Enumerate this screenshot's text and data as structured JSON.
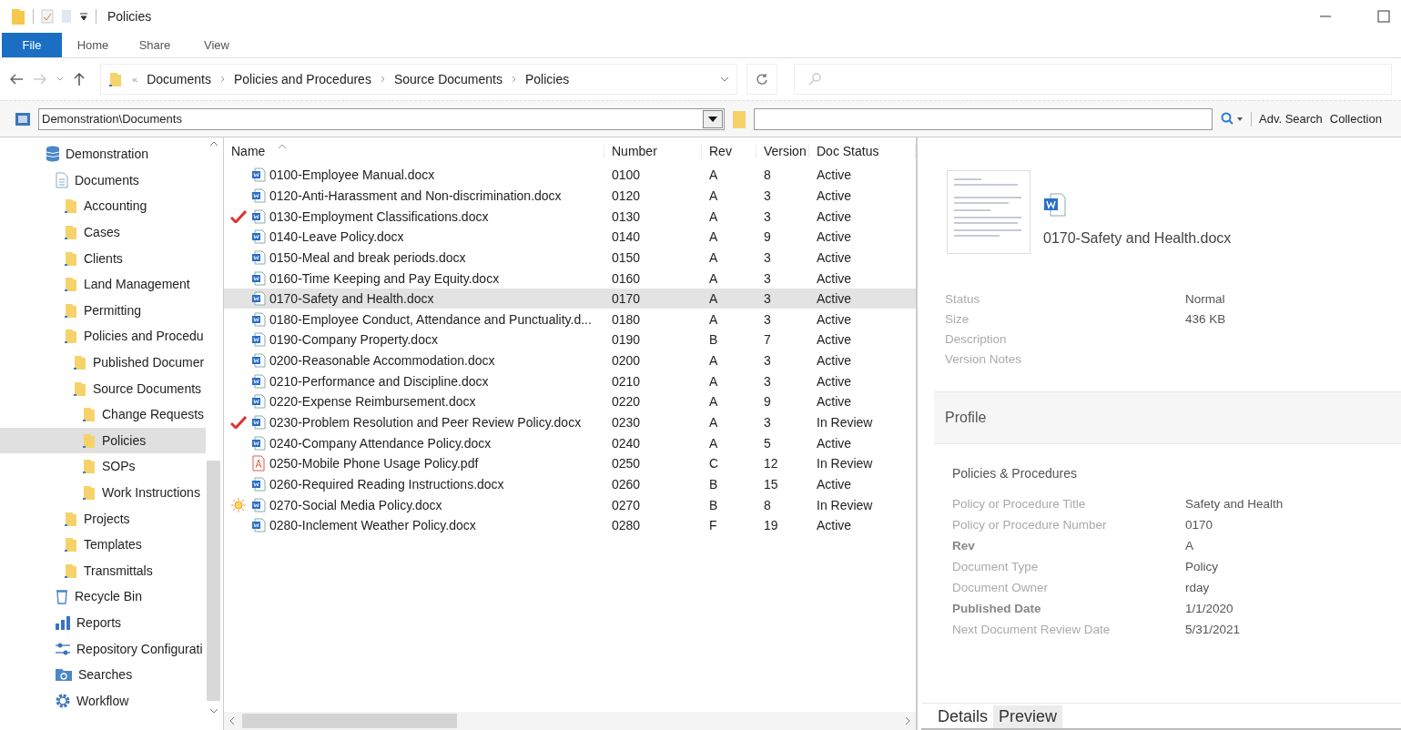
{
  "window": {
    "title": "Policies"
  },
  "ribbon_tabs": [
    {
      "label": "File",
      "selected": true
    },
    {
      "label": "Home",
      "selected": false
    },
    {
      "label": "Share",
      "selected": false
    },
    {
      "label": "View",
      "selected": false
    }
  ],
  "breadcrumb": {
    "overflow": "«",
    "parts": [
      "Documents",
      "Policies and Procedures",
      "Source Documents",
      "Policies"
    ]
  },
  "toolbar": {
    "location": "Demonstration\\Documents",
    "actions": [
      "Adv. Search",
      "Collection"
    ]
  },
  "tree": [
    {
      "label": "Demonstration",
      "kind": "database",
      "selected": false,
      "children": [
        {
          "label": "Documents",
          "kind": "documents",
          "selected": false,
          "children": [
            {
              "label": "Accounting",
              "kind": "folder",
              "selected": false
            },
            {
              "label": "Cases",
              "kind": "folder",
              "selected": false
            },
            {
              "label": "Clients",
              "kind": "folder",
              "selected": false
            },
            {
              "label": "Land Management",
              "kind": "folder",
              "selected": false
            },
            {
              "label": "Permitting",
              "kind": "folder",
              "selected": false
            },
            {
              "label": "Policies and Procedu",
              "kind": "folder",
              "selected": false,
              "children": [
                {
                  "label": "Published Documer",
                  "kind": "folder",
                  "selected": false
                },
                {
                  "label": "Source Documents",
                  "kind": "folder",
                  "selected": false,
                  "children": [
                    {
                      "label": "Change Requests",
                      "kind": "folder",
                      "selected": false
                    },
                    {
                      "label": "Policies",
                      "kind": "folder",
                      "selected": true
                    },
                    {
                      "label": "SOPs",
                      "kind": "folder",
                      "selected": false
                    },
                    {
                      "label": "Work Instructions",
                      "kind": "folder",
                      "selected": false
                    }
                  ]
                }
              ]
            },
            {
              "label": "Projects",
              "kind": "folder",
              "selected": false
            },
            {
              "label": "Templates",
              "kind": "folder",
              "selected": false
            },
            {
              "label": "Transmittals",
              "kind": "folder",
              "selected": false
            }
          ]
        },
        {
          "label": "Recycle Bin",
          "kind": "recycle",
          "selected": false
        },
        {
          "label": "Reports",
          "kind": "reports",
          "selected": false
        },
        {
          "label": "Repository Configurati",
          "kind": "config",
          "selected": false
        },
        {
          "label": "Searches",
          "kind": "searches",
          "selected": false
        },
        {
          "label": "Workflow",
          "kind": "workflow",
          "selected": false
        }
      ]
    }
  ],
  "table": {
    "columns": [
      "Name",
      "Number",
      "Rev",
      "Version",
      "Doc Status"
    ],
    "rows": [
      {
        "kind": "docx",
        "name": "0100-Employee Manual.docx",
        "number": "0100",
        "rev": "A",
        "version": "8",
        "status": "Active",
        "selected": false
      },
      {
        "kind": "docx",
        "name": "0120-Anti-Harassment and Non-discrimination.docx",
        "number": "0120",
        "rev": "A",
        "version": "3",
        "status": "Active",
        "selected": false
      },
      {
        "flag": {
          "kind": "check"
        },
        "kind": "docx",
        "name": "0130-Employment Classifications.docx",
        "number": "0130",
        "rev": "A",
        "version": "3",
        "status": "Active",
        "selected": false
      },
      {
        "kind": "docx",
        "name": "0140-Leave Policy.docx",
        "number": "0140",
        "rev": "A",
        "version": "9",
        "status": "Active",
        "selected": false
      },
      {
        "kind": "docx",
        "name": "0150-Meal and break periods.docx",
        "number": "0150",
        "rev": "A",
        "version": "3",
        "status": "Active",
        "selected": false
      },
      {
        "kind": "docx",
        "name": "0160-Time Keeping and Pay Equity.docx",
        "number": "0160",
        "rev": "A",
        "version": "3",
        "status": "Active",
        "selected": false
      },
      {
        "kind": "docx",
        "name": "0170-Safety and Health.docx",
        "number": "0170",
        "rev": "A",
        "version": "3",
        "status": "Active",
        "selected": true
      },
      {
        "kind": "docx",
        "name": "0180-Employee Conduct, Attendance and Punctuality.d...",
        "number": "0180",
        "rev": "A",
        "version": "3",
        "status": "Active",
        "selected": false
      },
      {
        "kind": "docx",
        "name": "0190-Company Property.docx",
        "number": "0190",
        "rev": "B",
        "version": "7",
        "status": "Active",
        "selected": false
      },
      {
        "kind": "docx",
        "name": "0200-Reasonable Accommodation.docx",
        "number": "0200",
        "rev": "A",
        "version": "3",
        "status": "Active",
        "selected": false
      },
      {
        "kind": "docx",
        "name": "0210-Performance and Discipline.docx",
        "number": "0210",
        "rev": "A",
        "version": "3",
        "status": "Active",
        "selected": false
      },
      {
        "kind": "docx",
        "name": "0220-Expense Reimbursement.docx",
        "number": "0220",
        "rev": "A",
        "version": "9",
        "status": "Active",
        "selected": false
      },
      {
        "flag": {
          "kind": "check"
        },
        "kind": "docx",
        "name": "0230-Problem Resolution and Peer Review Policy.docx",
        "number": "0230",
        "rev": "A",
        "version": "3",
        "status": "In Review",
        "selected": false
      },
      {
        "kind": "docx",
        "name": "0240-Company Attendance Policy.docx",
        "number": "0240",
        "rev": "A",
        "version": "5",
        "status": "Active",
        "selected": false
      },
      {
        "kind": "pdf",
        "name": "0250-Mobile Phone Usage Policy.pdf",
        "number": "0250",
        "rev": "C",
        "version": "12",
        "status": "In Review",
        "selected": false
      },
      {
        "kind": "docx",
        "name": "0260-Required Reading Instructions.docx",
        "number": "0260",
        "rev": "B",
        "version": "15",
        "status": "Active",
        "selected": false
      },
      {
        "flag": {
          "kind": "sun"
        },
        "kind": "docx",
        "name": "0270-Social Media Policy.docx",
        "number": "0270",
        "rev": "B",
        "version": "8",
        "status": "In Review",
        "selected": false
      },
      {
        "kind": "docx",
        "name": "0280-Inclement Weather Policy.docx",
        "number": "0280",
        "rev": "F",
        "version": "19",
        "status": "Active",
        "selected": false
      }
    ]
  },
  "details": {
    "file_name": "0170-Safety and Health.docx",
    "properties": [
      {
        "label": "Status",
        "value": "Normal"
      },
      {
        "label": "Size",
        "value": "436 KB"
      },
      {
        "label": "Description"
      },
      {
        "label": "Version Notes"
      }
    ],
    "profile_title": "Profile",
    "group_title": "Policies & Procedures",
    "fields": [
      {
        "label": "Policy or Procedure Title",
        "value": "Safety and Health",
        "required": false
      },
      {
        "label": "Policy or Procedure Number",
        "value": "0170",
        "required": false
      },
      {
        "label": "Rev",
        "value": "A",
        "required": true
      },
      {
        "label": "Document Type",
        "value": "Policy",
        "required": false
      },
      {
        "label": "Document Owner",
        "value": "rday",
        "required": false
      },
      {
        "label": "Published Date",
        "value": "1/1/2020",
        "required": true
      },
      {
        "label": "Next Document Review Date",
        "value": "5/31/2021",
        "required": false
      }
    ],
    "tabs": [
      {
        "label": "Details",
        "selected": true
      },
      {
        "label": "Preview",
        "selected": false
      }
    ]
  }
}
